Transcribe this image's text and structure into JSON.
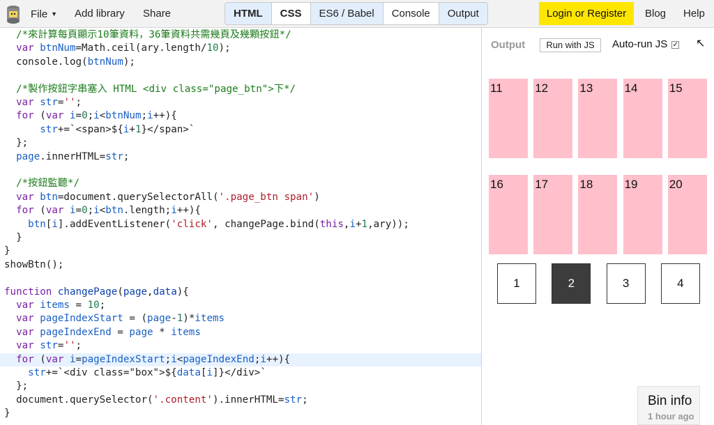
{
  "menu": {
    "file": "File",
    "add_library": "Add library",
    "share": "Share",
    "blog": "Blog",
    "help": "Help",
    "login": "Login or Register"
  },
  "tabs": [
    {
      "label": "HTML",
      "active": true,
      "bold": true
    },
    {
      "label": "CSS",
      "active": false,
      "bold": true
    },
    {
      "label": "ES6 / Babel",
      "active": true,
      "bold": false
    },
    {
      "label": "Console",
      "active": false,
      "bold": false
    },
    {
      "label": "Output",
      "active": true,
      "bold": false
    }
  ],
  "code": {
    "highlighted_line": 24,
    "lines": [
      [
        [
          "c-com",
          "  /*來計算每頁顯示10筆資料，36筆資料共需幾頁及幾顆按鈕*/"
        ]
      ],
      [
        [
          "",
          "  "
        ],
        [
          "c-kw",
          "var"
        ],
        [
          "",
          " "
        ],
        [
          "c-var",
          "btnNum"
        ],
        [
          "",
          "=Math.ceil(ary.length/"
        ],
        [
          "c-num",
          "10"
        ],
        [
          "",
          ");"
        ]
      ],
      [
        [
          "",
          "  console.log("
        ],
        [
          "c-var",
          "btnNum"
        ],
        [
          "",
          ");"
        ]
      ],
      [
        [
          "",
          ""
        ]
      ],
      [
        [
          "c-com",
          "  /*製作按鈕字串塞入 HTML <div class=\"page_btn\">下*/"
        ]
      ],
      [
        [
          "",
          "  "
        ],
        [
          "c-kw",
          "var"
        ],
        [
          "",
          " "
        ],
        [
          "c-var",
          "str"
        ],
        [
          "",
          "="
        ],
        [
          "c-str",
          "''"
        ],
        [
          "",
          ";"
        ]
      ],
      [
        [
          "",
          "  "
        ],
        [
          "c-kw",
          "for"
        ],
        [
          "",
          " ("
        ],
        [
          "c-kw",
          "var"
        ],
        [
          "",
          " "
        ],
        [
          "c-var",
          "i"
        ],
        [
          "",
          "="
        ],
        [
          "c-num",
          "0"
        ],
        [
          "",
          ";"
        ],
        [
          "c-var",
          "i"
        ],
        [
          "",
          "<"
        ],
        [
          "c-var",
          "btnNum"
        ],
        [
          "",
          ";"
        ],
        [
          "c-var",
          "i"
        ],
        [
          "",
          "++){"
        ]
      ],
      [
        [
          "",
          "      "
        ],
        [
          "c-var",
          "str"
        ],
        [
          "",
          "+=`<span>${"
        ],
        [
          "c-var",
          "i"
        ],
        [
          "",
          "+"
        ],
        [
          "c-num",
          "1"
        ],
        [
          "",
          "}</span>`"
        ]
      ],
      [
        [
          "",
          "  };"
        ]
      ],
      [
        [
          "",
          "  "
        ],
        [
          "c-var",
          "page"
        ],
        [
          "",
          ".innerHTML="
        ],
        [
          "c-var",
          "str"
        ],
        [
          "",
          ";"
        ]
      ],
      [
        [
          "",
          ""
        ]
      ],
      [
        [
          "c-com",
          "  /*按鈕監聽*/"
        ]
      ],
      [
        [
          "",
          "  "
        ],
        [
          "c-kw",
          "var"
        ],
        [
          "",
          " "
        ],
        [
          "c-var",
          "btn"
        ],
        [
          "",
          "=document.querySelectorAll("
        ],
        [
          "c-str",
          "'.page_btn span'"
        ],
        [
          "",
          ")"
        ]
      ],
      [
        [
          "",
          "  "
        ],
        [
          "c-kw",
          "for"
        ],
        [
          "",
          " ("
        ],
        [
          "c-kw",
          "var"
        ],
        [
          "",
          " "
        ],
        [
          "c-var",
          "i"
        ],
        [
          "",
          "="
        ],
        [
          "c-num",
          "0"
        ],
        [
          "",
          ";"
        ],
        [
          "c-var",
          "i"
        ],
        [
          "",
          "<"
        ],
        [
          "c-var",
          "btn"
        ],
        [
          "",
          ".length;"
        ],
        [
          "c-var",
          "i"
        ],
        [
          "",
          "++){"
        ]
      ],
      [
        [
          "",
          "    "
        ],
        [
          "c-var",
          "btn"
        ],
        [
          "",
          "["
        ],
        [
          "c-var",
          "i"
        ],
        [
          "",
          "].addEventListener("
        ],
        [
          "c-str",
          "'click'"
        ],
        [
          "",
          ", changePage.bind("
        ],
        [
          "c-kw",
          "this"
        ],
        [
          "",
          ","
        ],
        [
          "c-var",
          "i"
        ],
        [
          "",
          "+"
        ],
        [
          "c-num",
          "1"
        ],
        [
          "",
          ",ary));"
        ]
      ],
      [
        [
          "",
          "  }"
        ]
      ],
      [
        [
          "",
          "}"
        ]
      ],
      [
        [
          "",
          "showBtn();"
        ]
      ],
      [
        [
          "",
          ""
        ]
      ],
      [
        [
          "c-kw",
          "function"
        ],
        [
          "",
          " "
        ],
        [
          "c-def",
          "changePage"
        ],
        [
          "",
          "("
        ],
        [
          "c-def",
          "page"
        ],
        [
          "",
          ","
        ],
        [
          "c-def",
          "data"
        ],
        [
          "",
          "){"
        ]
      ],
      [
        [
          "",
          "  "
        ],
        [
          "c-kw",
          "var"
        ],
        [
          "",
          " "
        ],
        [
          "c-var",
          "items"
        ],
        [
          "",
          " = "
        ],
        [
          "c-num",
          "10"
        ],
        [
          "",
          ";"
        ]
      ],
      [
        [
          "",
          "  "
        ],
        [
          "c-kw",
          "var"
        ],
        [
          "",
          " "
        ],
        [
          "c-var",
          "pageIndexStart"
        ],
        [
          "",
          " = ("
        ],
        [
          "c-var",
          "page"
        ],
        [
          "",
          "-"
        ],
        [
          "c-num",
          "1"
        ],
        [
          "",
          ")*"
        ],
        [
          "c-var",
          "items"
        ]
      ],
      [
        [
          "",
          "  "
        ],
        [
          "c-kw",
          "var"
        ],
        [
          "",
          " "
        ],
        [
          "c-var",
          "pageIndexEnd"
        ],
        [
          "",
          " = "
        ],
        [
          "c-var",
          "page"
        ],
        [
          "",
          " * "
        ],
        [
          "c-var",
          "items"
        ]
      ],
      [
        [
          "",
          "  "
        ],
        [
          "c-kw",
          "var"
        ],
        [
          "",
          " "
        ],
        [
          "c-var",
          "str"
        ],
        [
          "",
          "="
        ],
        [
          "c-str",
          "''"
        ],
        [
          "",
          ";"
        ]
      ],
      [
        [
          "",
          "  "
        ],
        [
          "c-kw",
          "for"
        ],
        [
          "",
          " ("
        ],
        [
          "c-kw",
          "var"
        ],
        [
          "",
          " "
        ],
        [
          "c-var",
          "i"
        ],
        [
          "",
          "="
        ],
        [
          "c-var",
          "pageIndexStart"
        ],
        [
          "",
          ";"
        ],
        [
          "c-var",
          "i"
        ],
        [
          "",
          "<"
        ],
        [
          "c-var",
          "pageIndexEnd"
        ],
        [
          "",
          ";"
        ],
        [
          "c-var",
          "i"
        ],
        [
          "",
          "++){"
        ]
      ],
      [
        [
          "",
          "    "
        ],
        [
          "c-var",
          "str"
        ],
        [
          "",
          "+=`<div class=\"box\">${"
        ],
        [
          "c-var",
          "data"
        ],
        [
          "",
          "["
        ],
        [
          "c-var",
          "i"
        ],
        [
          "",
          "]}</div>`"
        ]
      ],
      [
        [
          "",
          "  };"
        ]
      ],
      [
        [
          "",
          "  document.querySelector("
        ],
        [
          "c-str",
          "'.content'"
        ],
        [
          "",
          ").innerHTML="
        ],
        [
          "c-var",
          "str"
        ],
        [
          "",
          ";"
        ]
      ],
      [
        [
          "",
          "}"
        ]
      ]
    ]
  },
  "output": {
    "title": "Output",
    "run_button": "Run with JS",
    "autorun_label": "Auto-run JS",
    "autorun_checked": true,
    "popout_icon": "arrow-up-left-icon",
    "boxes": [
      "11",
      "12",
      "13",
      "14",
      "15",
      "16",
      "17",
      "18",
      "19",
      "20"
    ],
    "pages": [
      "1",
      "2",
      "3",
      "4"
    ],
    "active_page": "2"
  },
  "bin_info": {
    "title": "Bin info",
    "time": "1 hour ago"
  }
}
